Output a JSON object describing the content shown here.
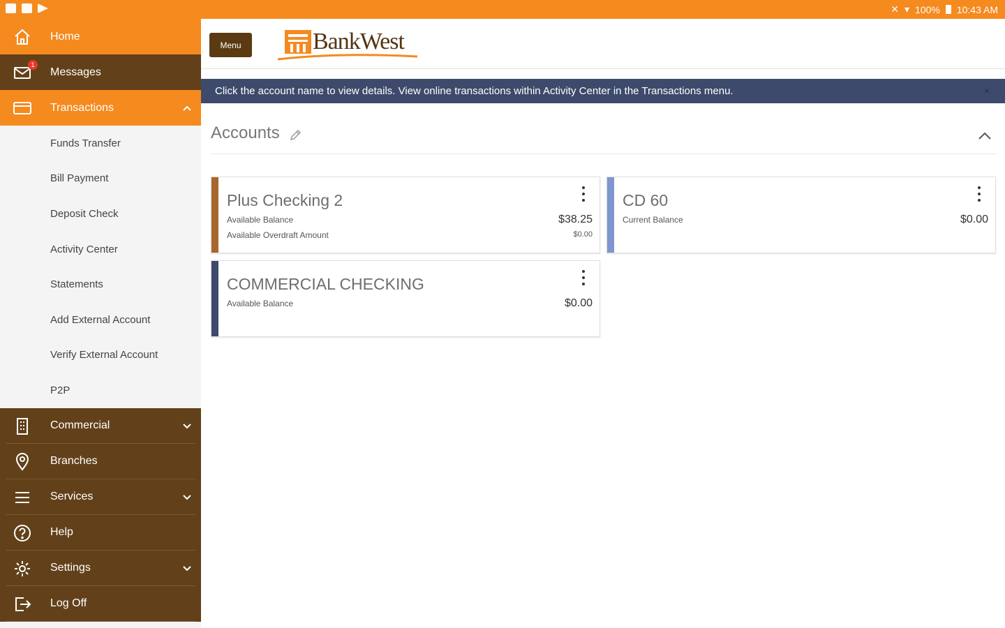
{
  "status_bar": {
    "battery": "100%",
    "time": "10:43 AM"
  },
  "sidebar": {
    "home": "Home",
    "messages": "Messages",
    "messages_badge": "1",
    "transactions": "Transactions",
    "sub_items": [
      "Funds Transfer",
      "Bill Payment",
      "Deposit Check",
      "Activity Center",
      "Statements",
      "Add External Account",
      "Verify External Account",
      "P2P"
    ],
    "commercial": "Commercial",
    "branches": "Branches",
    "services": "Services",
    "help": "Help",
    "settings": "Settings",
    "log_off": "Log Off"
  },
  "header": {
    "menu_label": "Menu",
    "brand": "BankWest"
  },
  "banner": {
    "text": "Click the account name to view details. View online transactions within Activity Center in the Transactions menu.",
    "close": "×"
  },
  "accounts": {
    "title": "Accounts",
    "cards": [
      {
        "name": "Plus Checking 2",
        "label1": "Available Balance",
        "value1": "$38.25",
        "label2": "Available Overdraft Amount",
        "value2": "$0.00",
        "color": "#a8652e"
      },
      {
        "name": "CD 60",
        "label1": "Current Balance",
        "value1": "$0.00",
        "color": "#7f96d0"
      },
      {
        "name": "COMMERCIAL CHECKING",
        "label1": "Available Balance",
        "value1": "$0.00",
        "color": "#3e4a6b"
      }
    ]
  },
  "colors": {
    "orange": "#f58a1f",
    "brown": "#62411a",
    "banner": "#3e4a6b"
  }
}
